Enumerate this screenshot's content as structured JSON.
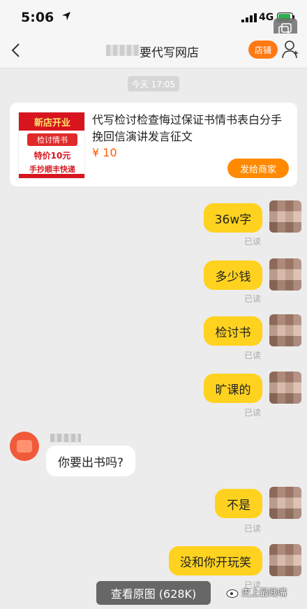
{
  "status_bar": {
    "time": "5:06",
    "network": "4G"
  },
  "nav": {
    "title": "要代写网店",
    "shop_button": "店铺"
  },
  "timestamp": "今天 17:05",
  "product": {
    "title": "代写检讨检查悔过保证书情书表白分手挽回信演讲发言征文",
    "price": "¥ 10",
    "send_button": "发给商家",
    "image_text": {
      "banner": "新店开业",
      "line1": "检讨情书",
      "line2": "特价10元",
      "line3": "手抄顺丰快递"
    }
  },
  "messages": [
    {
      "id": "m1",
      "direction": "out",
      "text": "36w字",
      "status": "已读"
    },
    {
      "id": "m2",
      "direction": "out",
      "text": "多少钱",
      "status": "已读"
    },
    {
      "id": "m3",
      "direction": "out",
      "text": "检讨书",
      "status": "已读"
    },
    {
      "id": "m4",
      "direction": "out",
      "text": "旷课的",
      "status": "已读"
    },
    {
      "id": "m5",
      "direction": "in",
      "text": "你要出书吗?"
    },
    {
      "id": "m6",
      "direction": "out",
      "text": "不是",
      "status": "已读"
    },
    {
      "id": "m7",
      "direction": "out",
      "text": "没和你开玩笑",
      "status": "已读"
    }
  ],
  "view_original_button": "查看原图 (628K)",
  "watermark": "史上最贱嘴",
  "colors": {
    "accent_orange": "#ff7a14",
    "bubble_yellow": "#ffd21f",
    "price": "#ff5a00"
  }
}
